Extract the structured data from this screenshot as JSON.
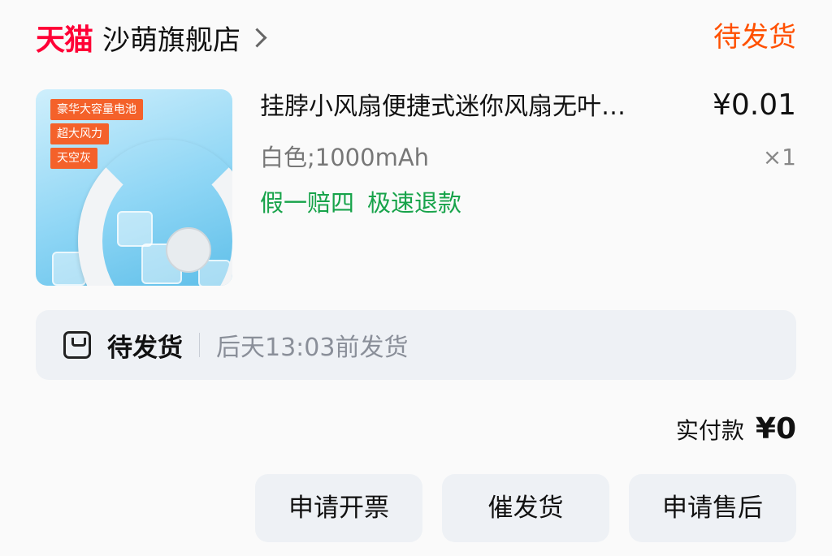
{
  "header": {
    "brand": "天猫",
    "shop_name": "沙萌旗舰店",
    "order_status": "待发货"
  },
  "product": {
    "image_tags": [
      "豪华大容量电池",
      "超大风力",
      "天空灰"
    ],
    "title": "挂脖小风扇便捷式迷你风扇无叶…",
    "price": "¥0.01",
    "sku": "白色;1000mAh",
    "quantity": "×1",
    "guarantees": [
      "假一赔四",
      "极速退款"
    ]
  },
  "shipping": {
    "status": "待发货",
    "eta": "后天13:03前发货"
  },
  "payment": {
    "label": "实付款",
    "amount": "¥0"
  },
  "actions": {
    "invoice": "申请开票",
    "urge": "催发货",
    "aftersale": "申请售后"
  },
  "colors": {
    "brand_red": "#ff0036",
    "status_orange": "#ff5000",
    "guarantee_green": "#17a34a"
  },
  "icons": {
    "chevron": "chevron-right-icon",
    "shipping": "package-box-icon"
  }
}
